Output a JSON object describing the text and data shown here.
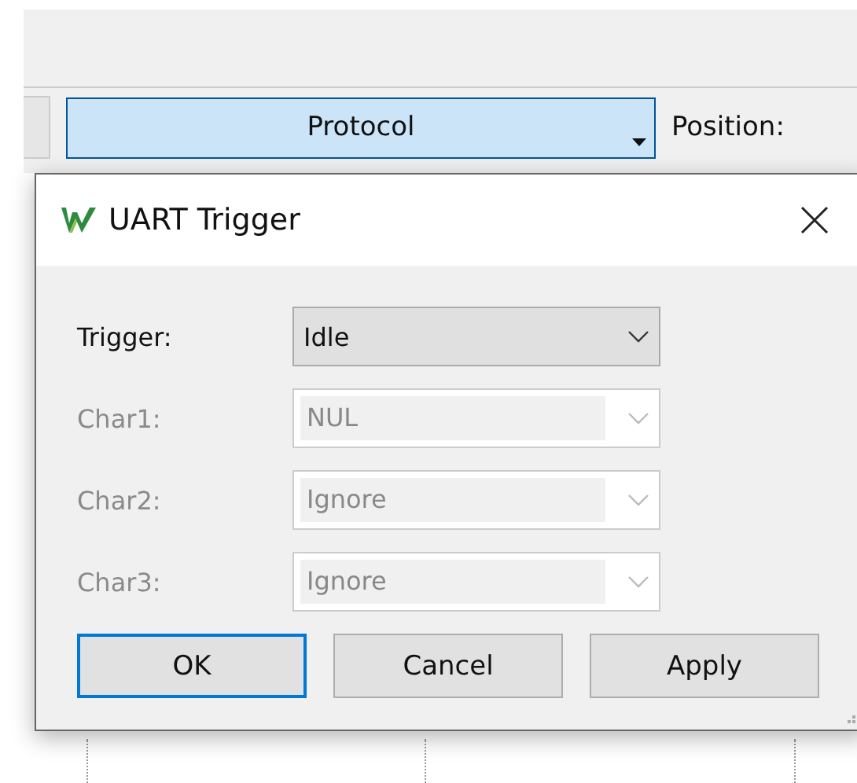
{
  "toolbar": {
    "protocol_button": {
      "label": "Protocol",
      "selected": true
    },
    "position_label": "Position:"
  },
  "dialog": {
    "title": "UART Trigger",
    "fields": [
      {
        "label": "Trigger:",
        "value": "Idle",
        "disabled": false
      },
      {
        "label": "Char1:",
        "value": "NUL",
        "disabled": true
      },
      {
        "label": "Char2:",
        "value": "Ignore",
        "disabled": true
      },
      {
        "label": "Char3:",
        "value": "Ignore",
        "disabled": true
      }
    ],
    "buttons": [
      {
        "label": "OK",
        "default": true
      },
      {
        "label": "Cancel",
        "default": false
      },
      {
        "label": "Apply",
        "default": false
      }
    ]
  }
}
